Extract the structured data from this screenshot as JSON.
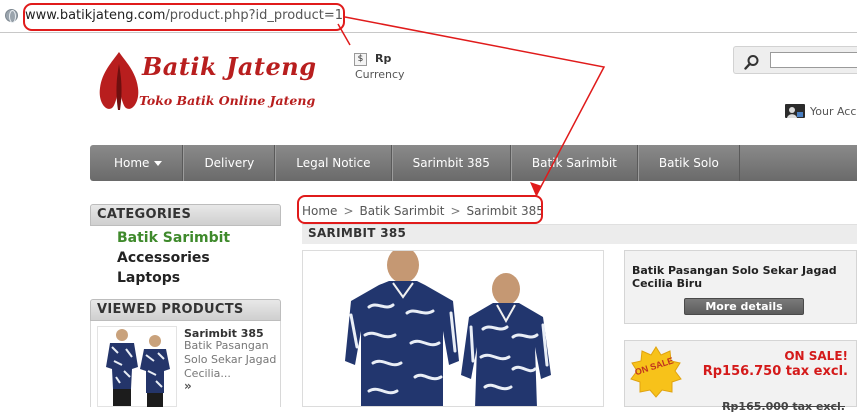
{
  "browser": {
    "url_host": "www.batikjateng.com",
    "url_rest": "/product.php?id_product=1"
  },
  "header": {
    "logo_title": "Batik Jateng",
    "logo_subtitle": "Toko Batik Online Jateng",
    "currency_symbol": "$",
    "currency_value": "Rp",
    "currency_label": "Currency",
    "account_text": "Your Acc"
  },
  "nav": {
    "items": [
      {
        "label": "Home"
      },
      {
        "label": "Delivery"
      },
      {
        "label": "Legal Notice"
      },
      {
        "label": "Sarimbit 385"
      },
      {
        "label": "Batik Sarimbit"
      },
      {
        "label": "Batik Solo"
      }
    ]
  },
  "sidebar": {
    "categories_title": "CATEGORIES",
    "categories": [
      {
        "label": "Batik Sarimbit"
      },
      {
        "label": "Accessories"
      },
      {
        "label": "Laptops"
      }
    ],
    "viewed_title": "VIEWED PRODUCTS",
    "viewed_item": {
      "title": "Sarimbit 385",
      "desc": "Batik Pasangan Solo Sekar Jagad Cecilia...",
      "more": "»"
    }
  },
  "breadcrumb": {
    "items": [
      "Home",
      "Batik Sarimbit",
      "Sarimbit 385"
    ],
    "separator": ">"
  },
  "product": {
    "title": "SARIMBIT 385",
    "related_title": "Batik Pasangan Solo Sekar Jagad Cecilia Biru",
    "more_details": "More details",
    "sale_badge": "ON SALE",
    "sale_label": "ON SALE!",
    "price": "Rp156.750 tax excl.",
    "old_price": "Rp165.000 tax excl."
  },
  "colors": {
    "brand_red": "#b81e1e",
    "annotation_red": "#e01b1b",
    "active_category": "#3f8a2c",
    "sale_red": "#d41a1a"
  }
}
